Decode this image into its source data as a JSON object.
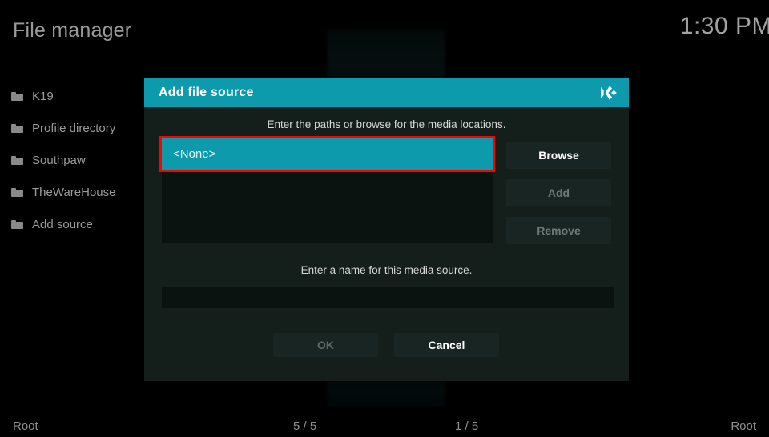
{
  "header": {
    "title": "File manager",
    "clock": "1:30 PM"
  },
  "sidebar": {
    "items": [
      {
        "label": "K19",
        "icon": "folder-icon"
      },
      {
        "label": "Profile directory",
        "icon": "folder-icon"
      },
      {
        "label": "Southpaw",
        "icon": "folder-icon"
      },
      {
        "label": "TheWareHouse",
        "icon": "folder-icon"
      },
      {
        "label": "Add source",
        "icon": "folder-icon"
      }
    ]
  },
  "dialog": {
    "title": "Add file source",
    "logo_icon": "kodi-logo-icon",
    "hint_paths": "Enter the paths or browse for the media locations.",
    "path_list": [
      {
        "label": "<None>",
        "selected": true
      }
    ],
    "buttons": {
      "browse": "Browse",
      "add": "Add",
      "remove": "Remove"
    },
    "hint_name": "Enter a name for this media source.",
    "name_value": "",
    "name_placeholder": "",
    "ok": "OK",
    "cancel": "Cancel"
  },
  "status_bar": {
    "left": "Root",
    "count_left": "5 / 5",
    "count_right": "1 / 5",
    "right": "Root"
  },
  "colors": {
    "accent": "#0d9aad",
    "highlight_box": "#ff0000",
    "dialog_bg": "#141f1c",
    "list_bg": "#0b1311"
  }
}
